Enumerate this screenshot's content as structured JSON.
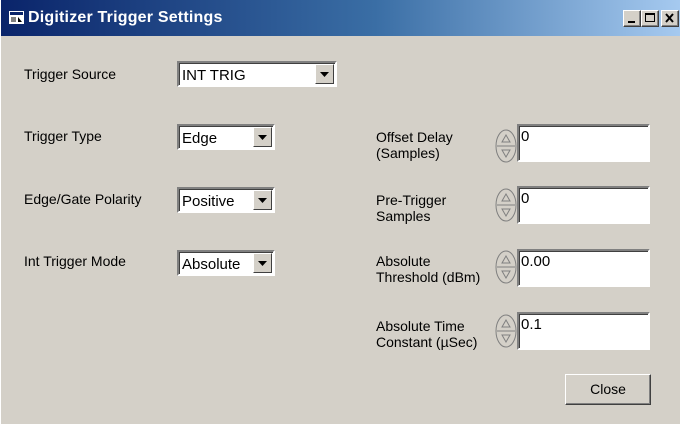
{
  "window": {
    "title": "Digitizer Trigger Settings",
    "title_icon": "app-icon",
    "controls": [
      "minimize-icon",
      "maximize-icon",
      "close-icon"
    ]
  },
  "left": {
    "trigger_source": {
      "label": "Trigger Source",
      "value": "INT TRIG"
    },
    "trigger_type": {
      "label": "Trigger Type",
      "value": "Edge"
    },
    "polarity": {
      "label": "Edge/Gate Polarity",
      "value": "Positive"
    },
    "int_mode": {
      "label": "Int Trigger Mode",
      "value": "Absolute"
    }
  },
  "right": {
    "offset_delay": {
      "label1": "Offset Delay",
      "label2": "(Samples)",
      "value": "0"
    },
    "pre_trigger": {
      "label1": "Pre-Trigger",
      "label2": "Samples",
      "value": "0"
    },
    "abs_threshold": {
      "label1": "Absolute",
      "label2": "Threshold (dBm)",
      "value": "0.00"
    },
    "abs_time": {
      "label1": "Absolute Time",
      "label2": "Constant (µSec)",
      "value": "0.1"
    }
  },
  "close_label": "Close"
}
